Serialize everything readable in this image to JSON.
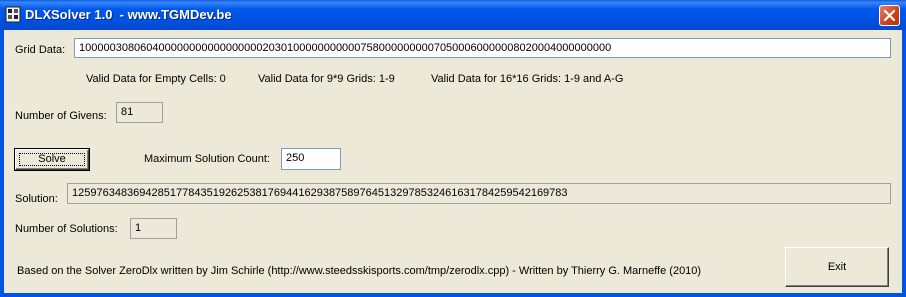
{
  "window": {
    "title": "DLXSolver 1.0  - www.TGMDev.be",
    "close_icon": "close-icon"
  },
  "grid": {
    "label": "Grid Data:",
    "value": "100000308060400000000000000000203010000000000075800000000070500060000008020004000000000"
  },
  "hints": {
    "empty": "Valid Data for Empty Cells: 0",
    "grid9": "Valid Data for 9*9 Grids: 1-9",
    "grid16": "Valid Data for 16*16 Grids: 1-9 and A-G"
  },
  "givens": {
    "label": "Number of Givens:",
    "value": "81"
  },
  "solve_button": "Solve",
  "max_count": {
    "label": "Maximum Solution Count:",
    "value": "250"
  },
  "solution": {
    "label": "Solution:",
    "value": "125976348369428517784351926253817694416293875897645132978532461631784259542169783"
  },
  "num_solutions": {
    "label": "Number of Solutions:",
    "value": "1"
  },
  "credits": "Based on the Solver ZeroDlx written by Jim Schirle (http://www.steedsskisports.com/tmp/zerodlx.cpp) - Written by Thierry G. Marneffe (2010)",
  "exit_button": "Exit"
}
